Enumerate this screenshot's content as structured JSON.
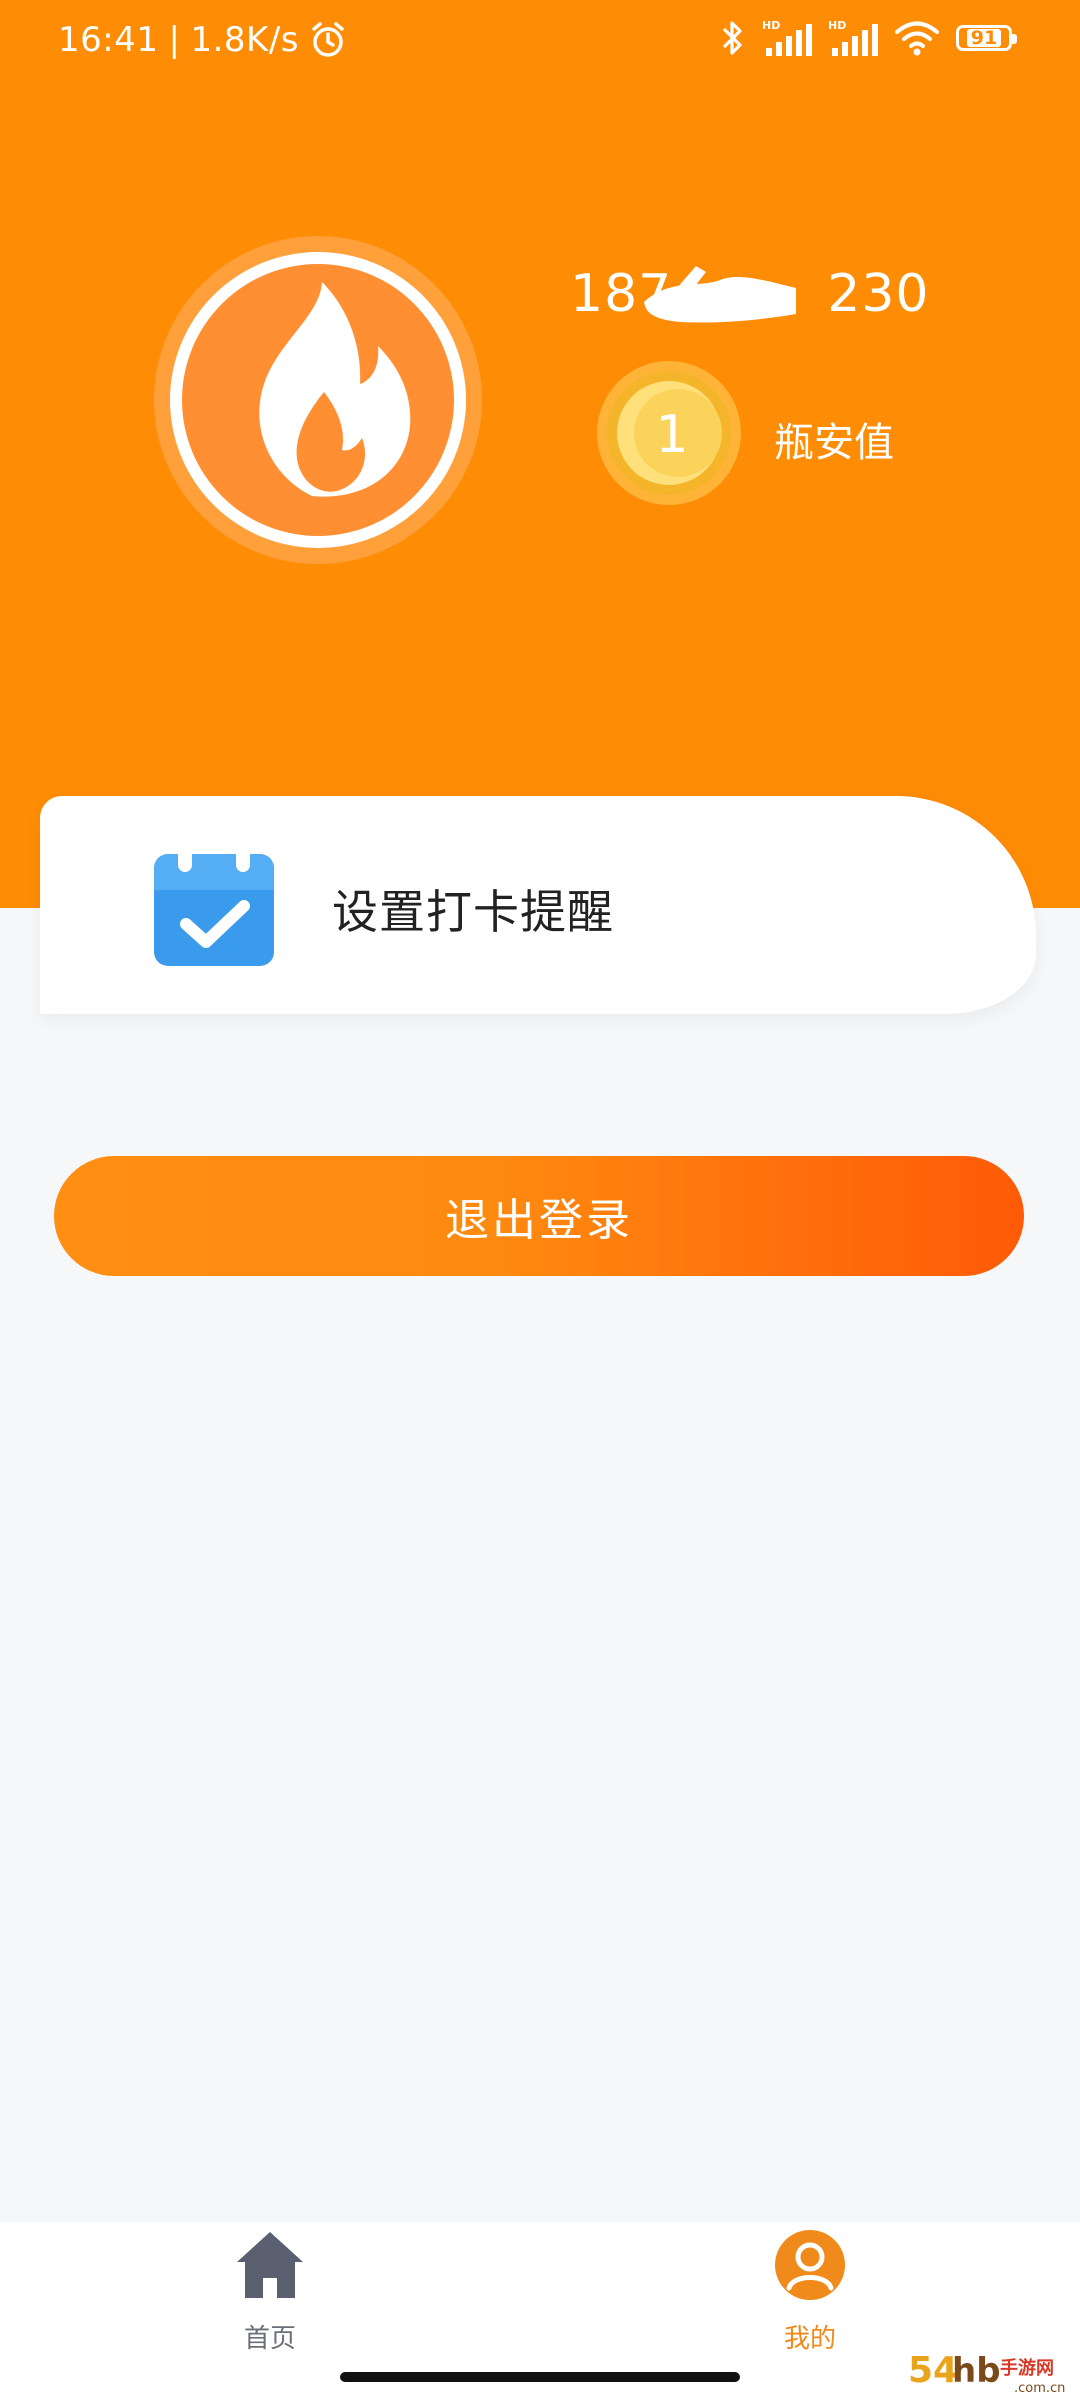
{
  "status_bar": {
    "time": "16:41",
    "network_speed": "1.8K/s",
    "battery": "91",
    "icons": [
      "alarm-icon",
      "bluetooth-icon",
      "signal-hd-icon",
      "signal-hd-icon",
      "wifi-icon",
      "battery-icon"
    ]
  },
  "profile": {
    "phone": "187",
    "phone_suffix": "230",
    "coin_value": "1",
    "value_label": "瓶安值",
    "avatar_icon": "flame-icon",
    "coin_icon": "coin-icon"
  },
  "reminder": {
    "label": "设置打卡提醒",
    "icon": "calendar-check-icon"
  },
  "logout": {
    "label": "退出登录"
  },
  "bottom_nav": {
    "items": [
      {
        "label": "首页",
        "icon": "home-icon",
        "active": false
      },
      {
        "label": "我的",
        "icon": "user-icon",
        "active": true
      }
    ]
  },
  "watermark": {
    "text": "54hb手游网",
    "domain": ".com.cn"
  },
  "colors": {
    "header": "#ff8c05",
    "page_background": "#f6f7f9",
    "button_start": "#ff8e12",
    "button_end": "#ff5a08",
    "active_nav": "#f08a1a",
    "inactive_nav": "#5a6070",
    "calendar_blue": "#3a9bec"
  }
}
